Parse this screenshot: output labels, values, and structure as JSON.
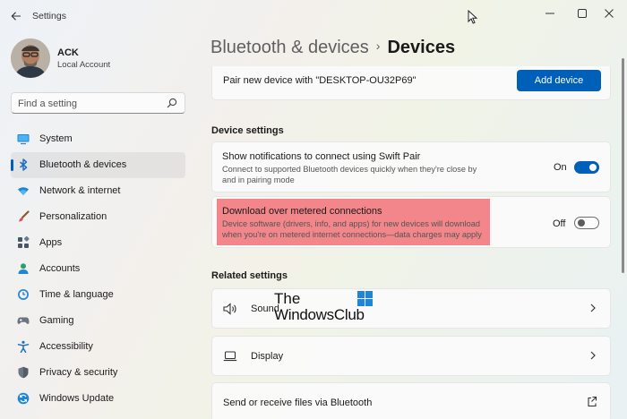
{
  "window": {
    "title": "Settings",
    "controls": [
      "minimize",
      "maximize",
      "close"
    ]
  },
  "user": {
    "name": "ACK",
    "account_type": "Local Account"
  },
  "search": {
    "placeholder": "Find a setting"
  },
  "sidebar": {
    "items": [
      {
        "label": "System",
        "icon": "monitor-icon",
        "active": false
      },
      {
        "label": "Bluetooth & devices",
        "icon": "bluetooth-icon",
        "active": true
      },
      {
        "label": "Network & internet",
        "icon": "wifi-icon",
        "active": false
      },
      {
        "label": "Personalization",
        "icon": "brush-icon",
        "active": false
      },
      {
        "label": "Apps",
        "icon": "apps-icon",
        "active": false
      },
      {
        "label": "Accounts",
        "icon": "person-icon",
        "active": false
      },
      {
        "label": "Time & language",
        "icon": "clock-globe-icon",
        "active": false
      },
      {
        "label": "Gaming",
        "icon": "gamepad-icon",
        "active": false
      },
      {
        "label": "Accessibility",
        "icon": "accessibility-icon",
        "active": false
      },
      {
        "label": "Privacy & security",
        "icon": "shield-icon",
        "active": false
      },
      {
        "label": "Windows Update",
        "icon": "update-icon",
        "active": false
      }
    ]
  },
  "breadcrumb": {
    "parent": "Bluetooth & devices",
    "separator": "›",
    "current": "Devices"
  },
  "pair": {
    "text": "Pair new device with \"DESKTOP-OU32P69\"",
    "button": "Add device"
  },
  "device_settings": {
    "heading": "Device settings",
    "swift_pair": {
      "title": "Show notifications to connect using Swift Pair",
      "description": "Connect to supported Bluetooth devices quickly when they're close by and in pairing mode",
      "state_label": "On",
      "on": true
    },
    "metered": {
      "title": "Download over metered connections",
      "description": "Device software (drivers, info, and apps) for new devices will download when you're on metered internet connections—data charges may apply",
      "state_label": "Off",
      "on": false
    }
  },
  "related_settings": {
    "heading": "Related settings",
    "items": [
      {
        "label": "Sound",
        "icon": "speaker-icon",
        "trailing": "chevron-right-icon"
      },
      {
        "label": "Display",
        "icon": "laptop-icon",
        "trailing": "chevron-right-icon"
      },
      {
        "label": "Send or receive files via Bluetooth",
        "icon": "",
        "trailing": "external-link-icon"
      }
    ]
  },
  "watermark": {
    "line1": "The",
    "line2": "WindowsClub"
  },
  "colors": {
    "accent": "#005fb8",
    "highlight": "#f2868a"
  }
}
